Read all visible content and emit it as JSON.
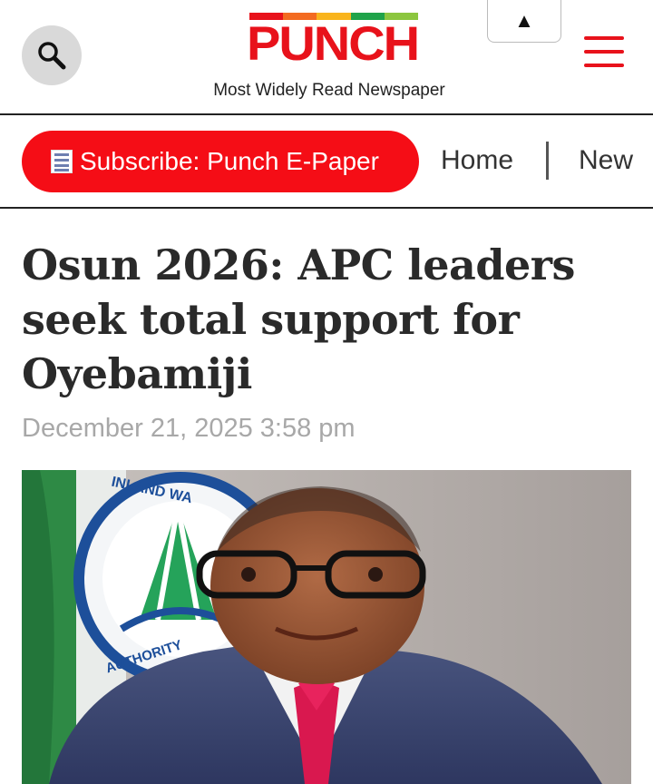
{
  "header": {
    "logo_text": "PUNCH",
    "tagline": "Most Widely Read Newspaper",
    "scroll_top_glyph": "▲",
    "search_icon": "search-icon",
    "menu_icon": "hamburger-menu-icon",
    "logo_stripe_colors": [
      "#e8121b",
      "#f36b21",
      "#f9b41c",
      "#1fa34a",
      "#8cc63f"
    ],
    "brand_color": "#e8121b"
  },
  "nav": {
    "subscribe_label": "Subscribe: Punch E-Paper",
    "home_label": "Home",
    "separator": "|",
    "next_label": "New"
  },
  "article": {
    "headline": "Osun 2026: APC leaders seek total support for Oyebamiji",
    "date": "December 21, 2025 3:58 pm",
    "photo": {
      "logo_text_top": "INLAND WA",
      "logo_text_bottom": "AUTHORITY"
    }
  }
}
